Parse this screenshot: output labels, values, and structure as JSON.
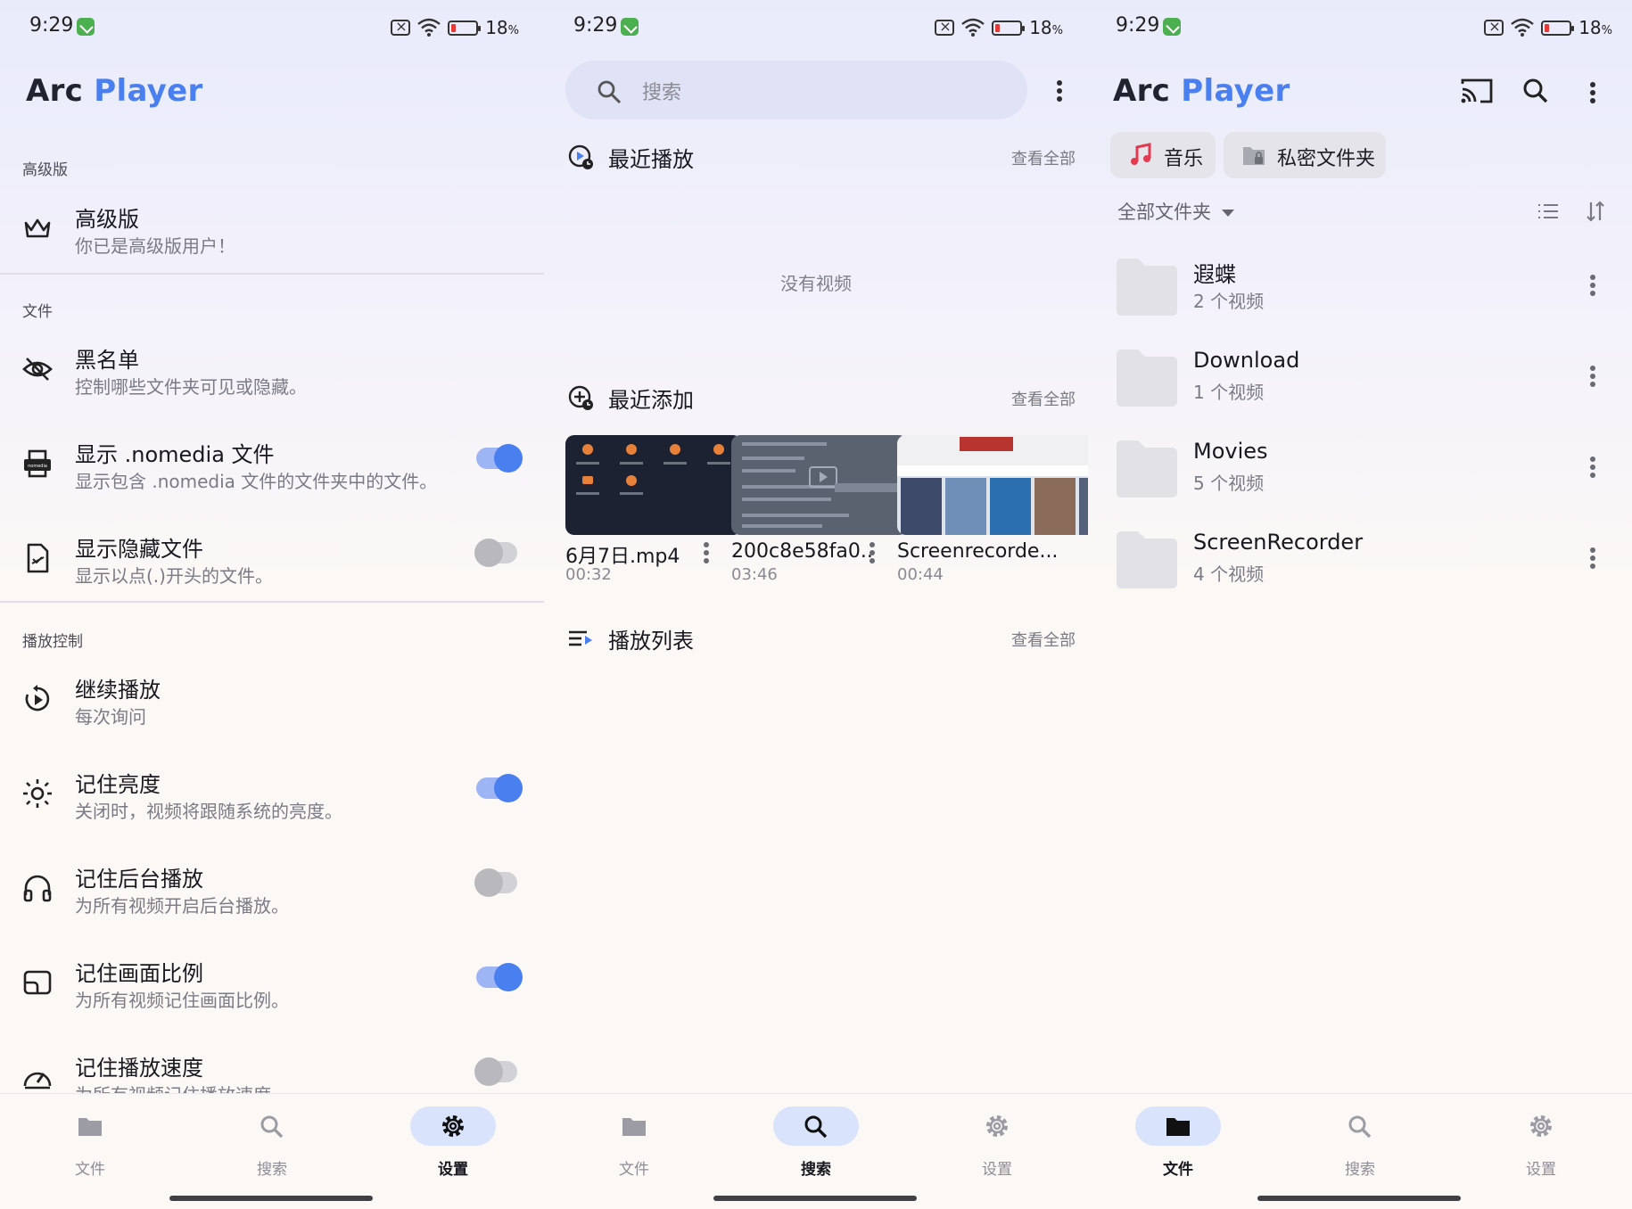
{
  "status_bar": {
    "time": "9:29",
    "battery": "18",
    "battery_unit": "%"
  },
  "app_title": {
    "part1": "Arc",
    "part2": "Player"
  },
  "settings": {
    "sections": {
      "premium": "高级版",
      "files": "文件",
      "playback": "播放控制"
    },
    "items": [
      {
        "title": "高级版",
        "subtitle": "你已是高级版用户！",
        "icon": "crown-icon"
      },
      {
        "title": "黑名单",
        "subtitle": "控制哪些文件夹可见或隐藏。",
        "icon": "eye-off-icon"
      },
      {
        "title": "显示 .nomedia 文件",
        "subtitle": "显示包含 .nomedia 文件的文件夹中的文件。",
        "icon": "nomedia-icon",
        "toggle": true
      },
      {
        "title": "显示隐藏文件",
        "subtitle": "显示以点(.)开头的文件。",
        "icon": "hidden-file-icon",
        "toggle": false
      },
      {
        "title": "继续播放",
        "subtitle": "每次询问",
        "icon": "resume-icon"
      },
      {
        "title": "记住亮度",
        "subtitle": "关闭时，视频将跟随系统的亮度。",
        "icon": "brightness-icon",
        "toggle": true
      },
      {
        "title": "记住后台播放",
        "subtitle": "为所有视频开启后台播放。",
        "icon": "headphones-icon",
        "toggle": false
      },
      {
        "title": "记住画面比例",
        "subtitle": "为所有视频记住画面比例。",
        "icon": "aspect-ratio-icon",
        "toggle": true
      },
      {
        "title": "记住播放速度",
        "subtitle": "为所有视频记住播放速度。",
        "icon": "speed-icon",
        "toggle": false
      }
    ]
  },
  "search_panel": {
    "placeholder": "搜索",
    "recent_played": {
      "title": "最近播放",
      "see_all": "查看全部",
      "empty": "没有视频"
    },
    "recent_added": {
      "title": "最近添加",
      "see_all": "查看全部",
      "videos": [
        {
          "name": "6月7日.mp4",
          "duration": "00:32"
        },
        {
          "name": "200c8e58fa0...",
          "duration": "03:46"
        },
        {
          "name": "Screenrecorde...",
          "duration": "00:44"
        }
      ]
    },
    "playlists": {
      "title": "播放列表",
      "see_all": "查看全部"
    }
  },
  "files_panel": {
    "chips": [
      {
        "label": "音乐",
        "icon": "music-note-icon"
      },
      {
        "label": "私密文件夹",
        "icon": "lock-folder-icon"
      }
    ],
    "filter": "全部文件夹",
    "folders": [
      {
        "name": "遐蝶",
        "count": "2 个视频"
      },
      {
        "name": "Download",
        "count": "1 个视频"
      },
      {
        "name": "Movies",
        "count": "5 个视频"
      },
      {
        "name": "ScreenRecorder",
        "count": "4 个视频"
      }
    ]
  },
  "nav": {
    "files": "文件",
    "search": "搜索",
    "settings": "设置"
  },
  "colors": {
    "accent": "#4a7ff0",
    "toggle_track_on": "#9eb5f5",
    "nav_active": "#d9e3fb",
    "music_red": "#e53950"
  }
}
